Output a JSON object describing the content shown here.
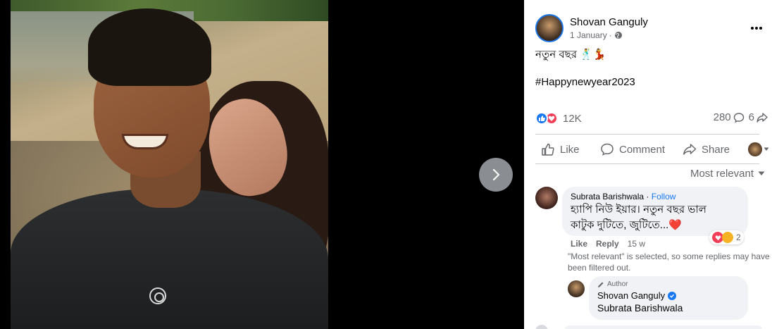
{
  "post": {
    "author": "Shovan Ganguly",
    "date": "1 January",
    "date_sep": "·",
    "text": "নতুন বছর 🕺💃",
    "hashtag": "#Happynewyear2023",
    "reaction_count": "12K",
    "comment_count": "280",
    "share_count": "6"
  },
  "actions": {
    "like": "Like",
    "comment": "Comment",
    "share": "Share"
  },
  "sort": {
    "label": "Most relevant"
  },
  "comment": {
    "author": "Subrata Barishwala",
    "separator": "·",
    "follow": "Follow",
    "line1": "হ্যাপি নিউ ইয়ার। নতুন বছর ভাল",
    "line2": "কাটুক দুটিতে, জুটিতে...❤️",
    "reaction_count": "2",
    "like": "Like",
    "reply": "Reply",
    "time": "15 w",
    "note": "\"Most relevant\" is selected, so some replies may have been filtered out."
  },
  "reply": {
    "badge": "Author",
    "author": "Shovan Ganguly",
    "text": "Subrata Barishwala"
  },
  "colors": {
    "accent": "#1877f2",
    "love": "#f33e58",
    "muted": "#65676b",
    "bubble": "#f0f2f5"
  },
  "icons": [
    "globe-icon",
    "more-icon",
    "like-icon",
    "comment-icon",
    "share-icon",
    "chevron-right-icon",
    "chevron-down-icon",
    "pencil-icon",
    "verified-icon"
  ]
}
